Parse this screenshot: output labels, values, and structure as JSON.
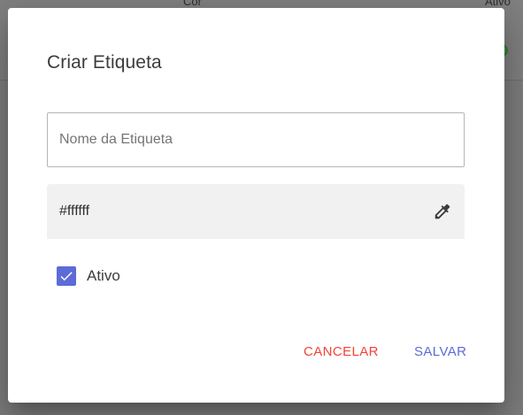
{
  "background": {
    "columns": [
      "Cor",
      "Ativo"
    ]
  },
  "dialog": {
    "title": "Criar Etiqueta",
    "name_field": {
      "placeholder": "Nome da Etiqueta",
      "value": ""
    },
    "color_field": {
      "value": "#ffffff",
      "icon": "eyedropper-icon"
    },
    "active_checkbox": {
      "label": "Ativo",
      "checked": true
    },
    "actions": {
      "cancel_label": "CANCELAR",
      "save_label": "SALVAR"
    }
  },
  "colors": {
    "primary": "#5c6bd8",
    "danger": "#f44336"
  }
}
